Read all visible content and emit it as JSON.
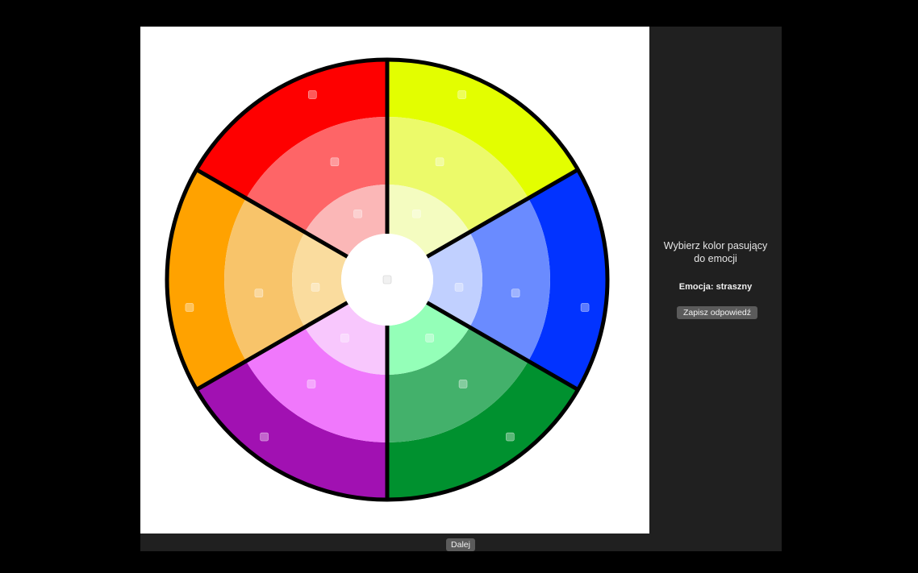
{
  "panel": {
    "prompt_line1": "Wybierz kolor pasujący",
    "prompt_line2": "do emocji",
    "emotion_label": "Emocja: straszny",
    "save_label": "Zapisz odpowiedź"
  },
  "footer": {
    "next_label": "Dalej"
  },
  "wheel": {
    "outline_color": "#000000",
    "center_color": "#ffffff",
    "segments": [
      {
        "name": "yellow",
        "colors": [
          "#e3fe00",
          "#ecfa6a",
          "#f4fcc0"
        ]
      },
      {
        "name": "blue",
        "colors": [
          "#0233ff",
          "#6a8bff",
          "#c1d0ff"
        ]
      },
      {
        "name": "green",
        "colors": [
          "#00912f",
          "#43b16b",
          "#94ffb8"
        ]
      },
      {
        "name": "purple",
        "colors": [
          "#a111b2",
          "#f078fc",
          "#f8c7fd"
        ]
      },
      {
        "name": "orange",
        "colors": [
          "#ffa200",
          "#f8c46a",
          "#fadc9e"
        ]
      },
      {
        "name": "red",
        "colors": [
          "#fe0000",
          "#fe6567",
          "#fbb7b7"
        ]
      }
    ]
  }
}
